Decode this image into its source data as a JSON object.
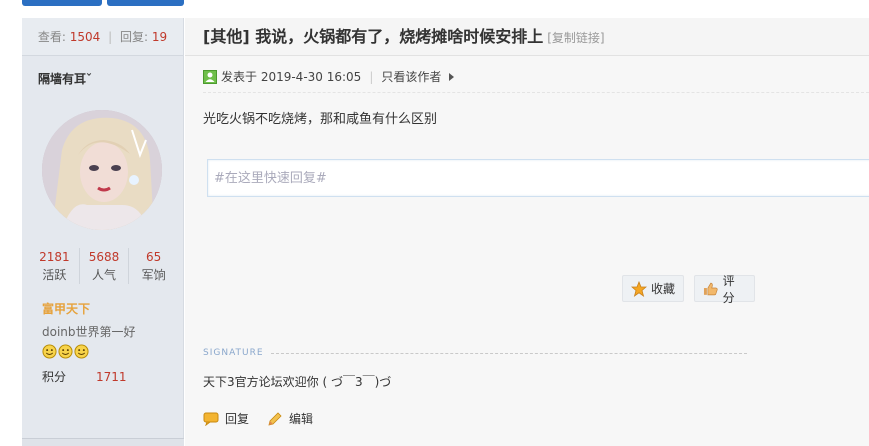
{
  "stats": {
    "views_label": "查看:",
    "views": "1504",
    "replies_label": "回复:",
    "replies": "19"
  },
  "user": {
    "name": "隔墙有耳ˇ",
    "numbers": [
      {
        "value": "2181",
        "label": "活跃"
      },
      {
        "value": "5688",
        "label": "人气"
      },
      {
        "value": "65",
        "label": "军饷"
      }
    ],
    "rank": "富甲天下",
    "motto": "doinb世界第一好",
    "medals": [
      "smiley-icon",
      "smiley-icon",
      "smiley-icon"
    ],
    "score_label": "积分",
    "score": "1711"
  },
  "post": {
    "title": "[其他] 我说，火锅都有了，烧烤摊啥时候安排上",
    "copy_link": "[复制链接]",
    "posted": "发表于 2019-4-30 16:05",
    "only_author": "只看该作者",
    "content": "光吃火锅不吃烧烤，那和咸鱼有什么区别",
    "reply_placeholder": "#在这里快速回复#",
    "favorite_label": "收藏",
    "rate_label": "评分",
    "signature_label": "SIGNATURE",
    "signature": "天下3官方论坛欢迎你 ( づ￣3￣)づ",
    "reply_label": "回复",
    "edit_label": "编辑"
  },
  "colors": {
    "accent_red": "#c0392b",
    "rank_gold": "#e6a23c",
    "brand_blue": "#2b6fc2"
  }
}
